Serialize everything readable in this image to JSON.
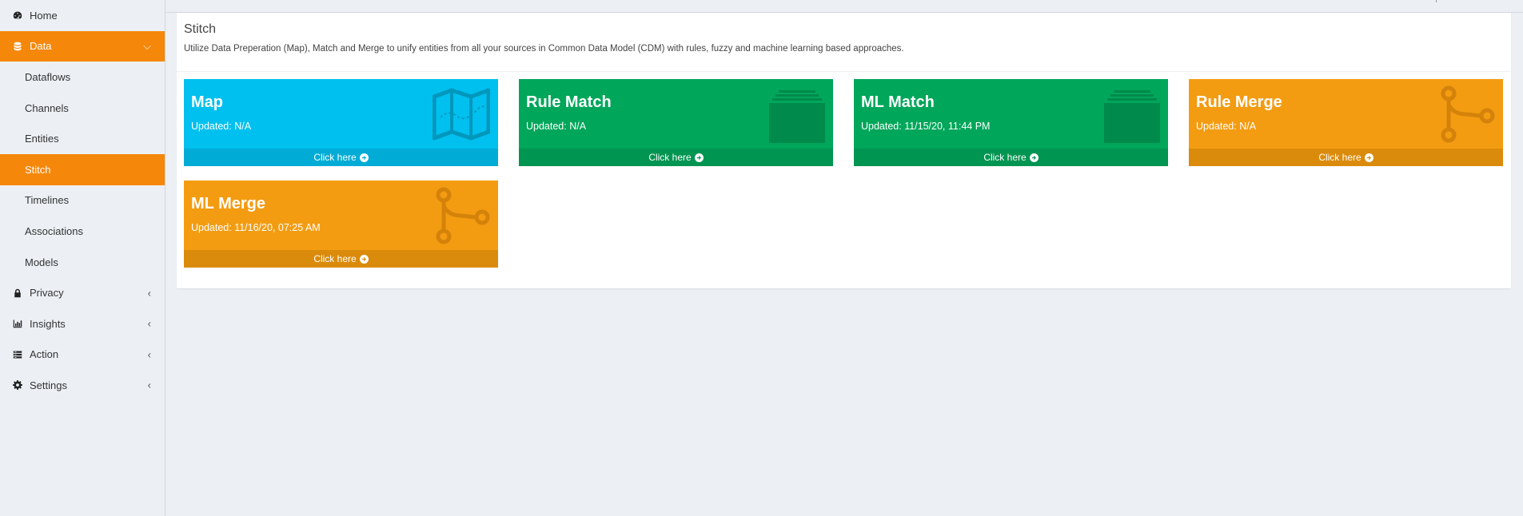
{
  "sidebar": {
    "items": [
      {
        "label": "Home",
        "icon": "dashboard-icon"
      },
      {
        "label": "Data",
        "icon": "database-icon",
        "expanded": true
      },
      {
        "label": "Privacy",
        "icon": "lock-icon"
      },
      {
        "label": "Insights",
        "icon": "bar-chart-icon"
      },
      {
        "label": "Action",
        "icon": "list-icon"
      },
      {
        "label": "Settings",
        "icon": "gear-icon"
      }
    ],
    "data_subitems": [
      {
        "label": "Dataflows"
      },
      {
        "label": "Channels"
      },
      {
        "label": "Entities"
      },
      {
        "label": "Stitch",
        "active": true
      },
      {
        "label": "Timelines"
      },
      {
        "label": "Associations"
      },
      {
        "label": "Models"
      }
    ]
  },
  "main": {
    "title": "Stitch",
    "description": "Utilize Data Preperation (Map), Match and Merge to unify entities from all your sources in Common Data Model (CDM) with rules, fuzzy and machine learning based approaches.",
    "tiles": [
      {
        "title": "Map",
        "updated": "Updated: N/A",
        "link": "Click here",
        "color": "#00c0ef",
        "icon": "map-icon"
      },
      {
        "title": "Rule Match",
        "updated": "Updated: N/A",
        "link": "Click here",
        "color": "#00a65a",
        "icon": "layers-icon"
      },
      {
        "title": "ML Match",
        "updated": "Updated: 11/15/20, 11:44 PM",
        "link": "Click here",
        "color": "#00a65a",
        "icon": "layers-icon"
      },
      {
        "title": "Rule Merge",
        "updated": "Updated: N/A",
        "link": "Click here",
        "color": "#f39c12",
        "icon": "merge-icon"
      },
      {
        "title": "ML Merge",
        "updated": "Updated: 11/16/20, 07:25 AM",
        "link": "Click here",
        "color": "#f39c12",
        "icon": "merge-icon"
      }
    ]
  },
  "colors": {
    "accent": "#f5870a",
    "blue": "#00c0ef",
    "green": "#00a65a",
    "orange": "#f39c12"
  }
}
